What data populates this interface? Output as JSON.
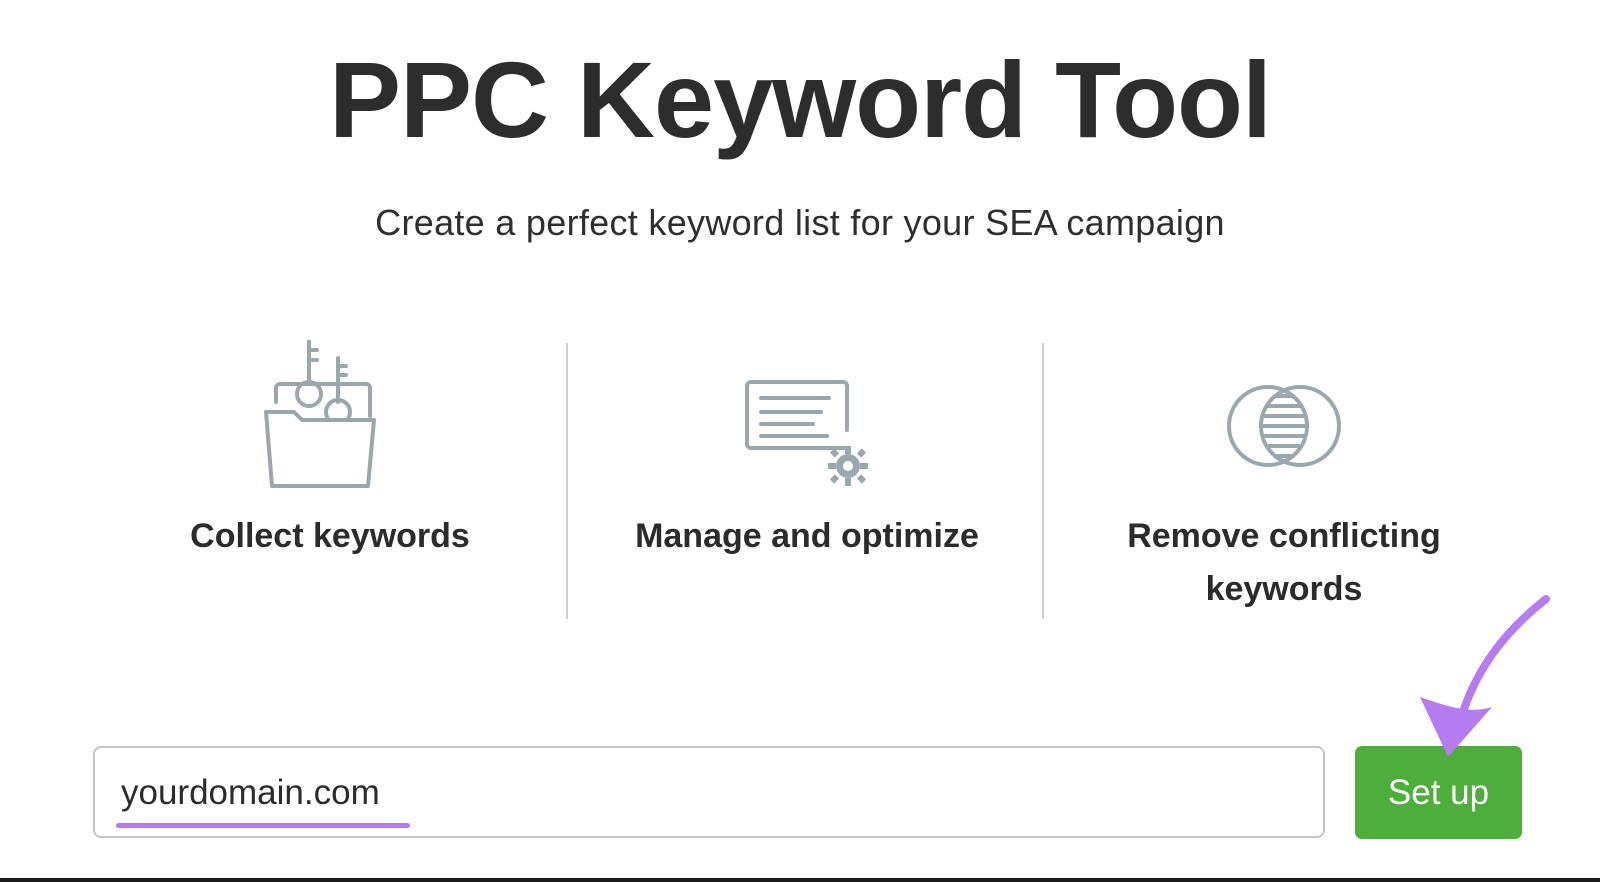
{
  "title": "PPC Keyword Tool",
  "subtitle": "Create a perfect keyword list for your SEA campaign",
  "features": [
    {
      "label": "Collect keywords",
      "icon": "folder-keys-icon"
    },
    {
      "label": "Manage and optimize",
      "icon": "document-gear-icon"
    },
    {
      "label": "Remove conflicting keywords",
      "icon": "venn-overlap-icon"
    }
  ],
  "domain_input": {
    "value": "yourdomain.com"
  },
  "setup_button": {
    "label": "Set up"
  },
  "colors": {
    "icon_stroke": "#9aa8ad",
    "button_green": "#4eae3c",
    "annotation_purple": "#b57bf0",
    "text_dark": "#2b2b2b"
  }
}
